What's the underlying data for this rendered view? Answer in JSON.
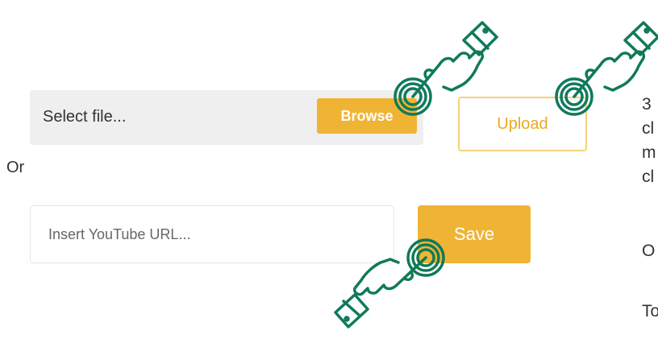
{
  "file_picker": {
    "label": "Select file...",
    "browse_label": "Browse"
  },
  "upload_label": "Upload",
  "or_label": "Or",
  "youtube": {
    "placeholder": "Insert YouTube URL...",
    "save_label": "Save"
  },
  "side_text": {
    "line1": "3",
    "line2": "cl",
    "line3": "m",
    "line4": "cl",
    "line5": "O",
    "line6": "To"
  },
  "colors": {
    "accent": "#f0b434",
    "hand_pointer": "#0f7a5a"
  },
  "icons": [
    "pointing-hand-icon",
    "tap-ripple-icon"
  ]
}
